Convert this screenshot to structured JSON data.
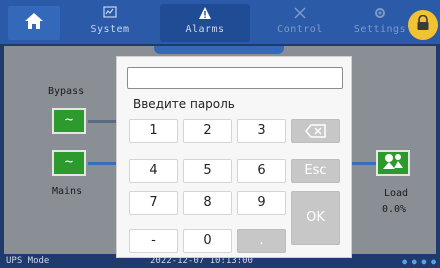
{
  "nav": {
    "tabs": [
      {
        "label": "System",
        "icon": "chart-monitor-icon"
      },
      {
        "label": "Alarms",
        "icon": "warning-icon"
      },
      {
        "label": "Control",
        "icon": "tools-icon"
      },
      {
        "label": "Settings",
        "icon": "gear-icon"
      }
    ]
  },
  "diagram": {
    "bypass_label": "Bypass",
    "mains_label": "Mains",
    "load_label": "Load",
    "load_value": "0.0%"
  },
  "dialog": {
    "password_value": "",
    "prompt": "Введите пароль",
    "keys": {
      "k1": "1",
      "k2": "2",
      "k3": "3",
      "k4": "4",
      "k5": "5",
      "k6": "6",
      "k7": "7",
      "k8": "8",
      "k9": "9",
      "minus": "-",
      "k0": "0",
      "dot": ".",
      "esc": "Esc",
      "ok": "OK"
    }
  },
  "status": {
    "mode": "UPS Mode",
    "datetime": "2022-12-07 10:13:00"
  },
  "colors": {
    "nav_bg": "#2a5aa8",
    "accent_green": "#2c9a2c",
    "lock_yellow": "#f1c232"
  }
}
